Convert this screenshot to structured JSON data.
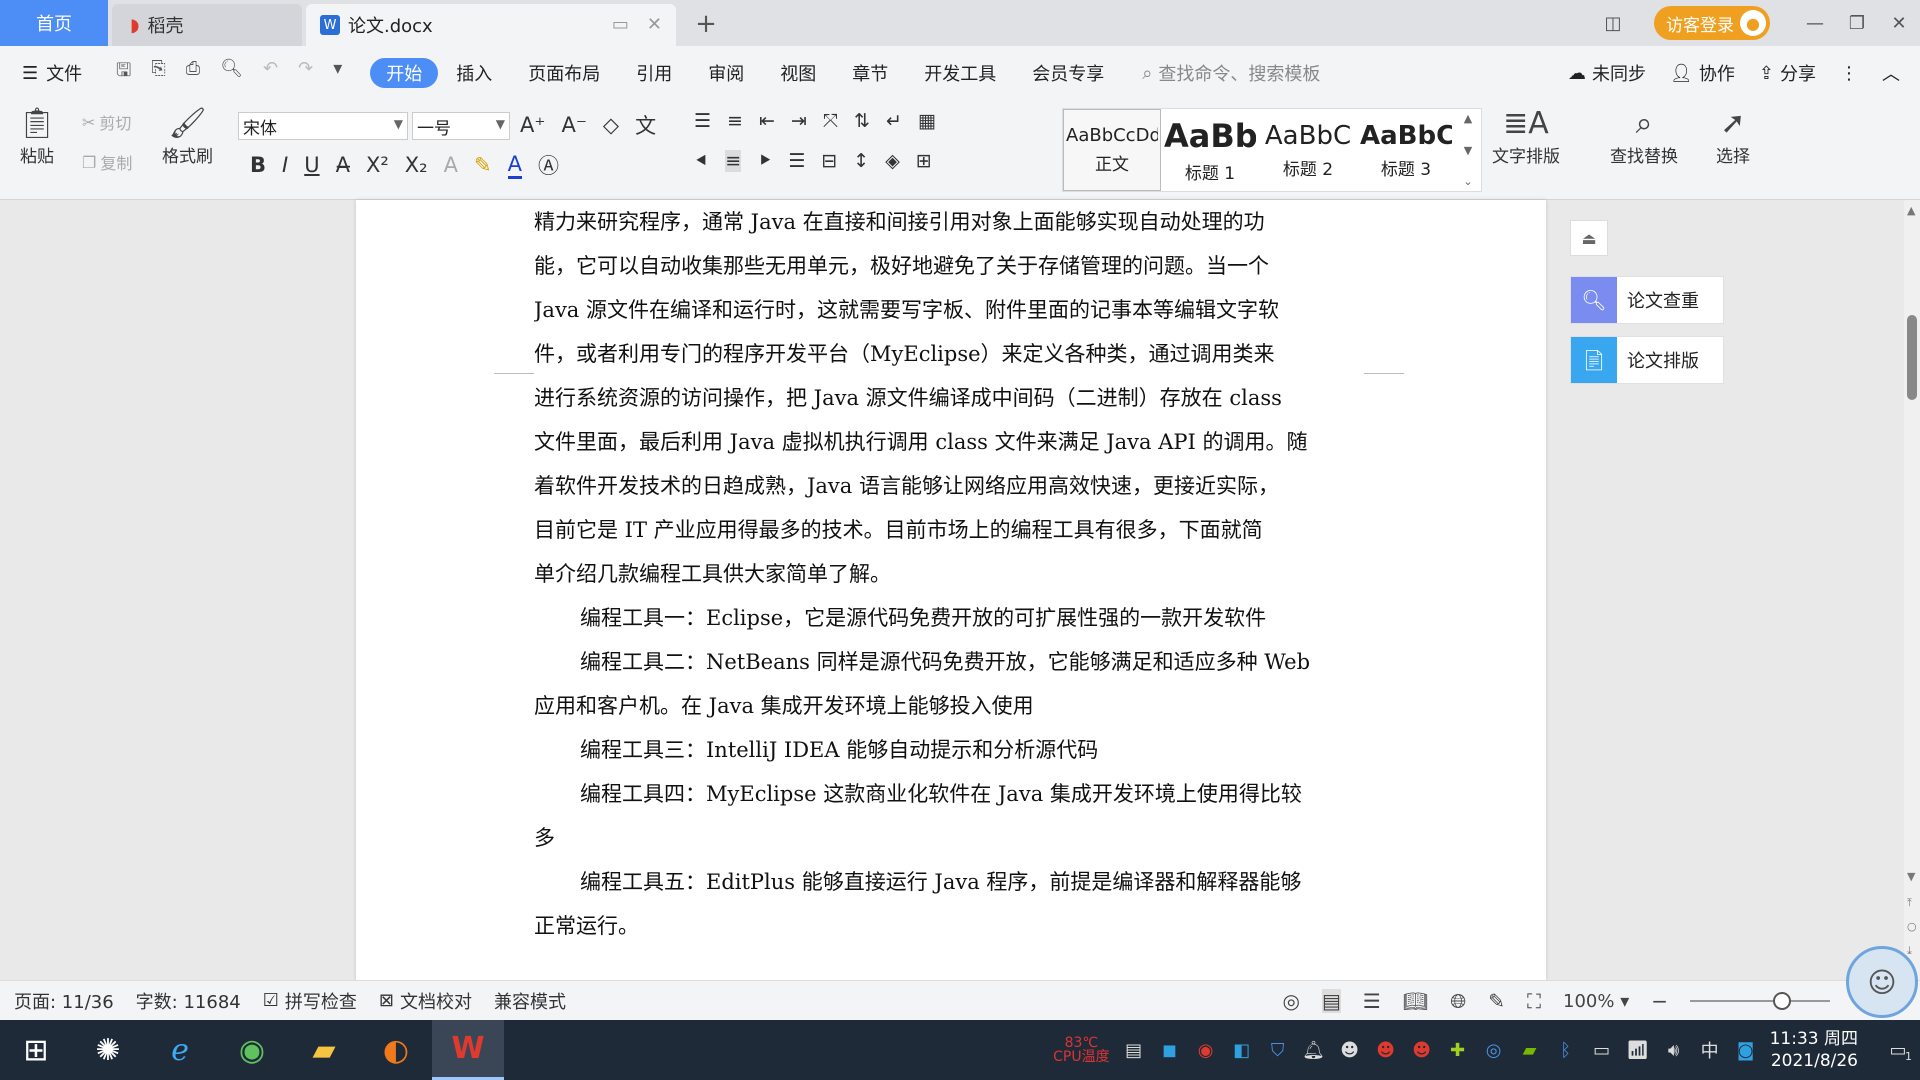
{
  "tabs": {
    "home": "首页",
    "daoke": "稻壳",
    "doc": "论文.docx",
    "login": "访客登录"
  },
  "menu": {
    "file": "文件",
    "tabs": [
      "开始",
      "插入",
      "页面布局",
      "引用",
      "审阅",
      "视图",
      "章节",
      "开发工具",
      "会员专享"
    ],
    "search_placeholder": "查找命令、搜索模板",
    "unsynced": "未同步",
    "collab": "协作",
    "share": "分享"
  },
  "ribbon": {
    "paste": "粘贴",
    "cut": "剪切",
    "copy": "复制",
    "format_painter": "格式刷",
    "font": "宋体",
    "size": "一号",
    "styles": [
      {
        "preview": "AaBbCcDd",
        "name": "正文"
      },
      {
        "preview": "AaBb",
        "name": "标题 1"
      },
      {
        "preview": "AaBbC",
        "name": "标题 2"
      },
      {
        "preview": "AaBbC",
        "name": "标题 3"
      }
    ],
    "text_layout": "文字排版",
    "find_replace": "查找替换",
    "select": "选择"
  },
  "document": {
    "lines": [
      {
        "text": "精力来研究程序，通常 Java 在直接和间接引用对象上面能够实现自动处理的功",
        "indent": false
      },
      {
        "text": "能，它可以自动收集那些无用单元，极好地避免了关于存储管理的问题。当一个",
        "indent": false
      },
      {
        "text": "Java 源文件在编译和运行时，这就需要写字板、附件里面的记事本等编辑文字软",
        "indent": false
      },
      {
        "text": "件，或者利用专门的程序开发平台（MyEclipse）来定义各种类，通过调用类来",
        "indent": false
      },
      {
        "text": "进行系统资源的访问操作，把 Java 源文件编译成中间码（二进制）存放在 class",
        "indent": false
      },
      {
        "text": "文件里面，最后利用 Java 虚拟机执行调用 class 文件来满足 Java API 的调用。随",
        "indent": false
      },
      {
        "text": "着软件开发技术的日趋成熟，Java 语言能够让网络应用高效快速，更接近实际，",
        "indent": false
      },
      {
        "text": "目前它是 IT 产业应用得最多的技术。目前市场上的编程工具有很多，下面就简",
        "indent": false
      },
      {
        "text": "单介绍几款编程工具供大家简单了解。",
        "indent": false
      },
      {
        "text": "编程工具一：Eclipse，它是源代码免费开放的可扩展性强的一款开发软件",
        "indent": true
      },
      {
        "text": "编程工具二：NetBeans 同样是源代码免费开放，它能够满足和适应多种 Web",
        "indent": true
      },
      {
        "text": "应用和客户机。在 Java 集成开发环境上能够投入使用",
        "indent": false
      },
      {
        "text": "编程工具三：IntelliJ IDEA 能够自动提示和分析源代码",
        "indent": true
      },
      {
        "text": "编程工具四：MyEclipse 这款商业化软件在 Java 集成开发环境上使用得比较",
        "indent": true
      },
      {
        "text": "多",
        "indent": false
      },
      {
        "text": "编程工具五：EditPlus 能够直接运行 Java 程序，前提是编译器和解释器能够",
        "indent": true
      },
      {
        "text": "正常运行。",
        "indent": false
      }
    ]
  },
  "side_panel": {
    "check": "论文查重",
    "layout": "论文排版"
  },
  "status": {
    "page": "页面: 11/36",
    "words": "字数: 11684",
    "spell": "拼写检查",
    "proof": "文档校对",
    "compat": "兼容模式",
    "zoom": "100%",
    "zoom_level": 0.66
  },
  "taskbar": {
    "cpu_temp_value": "83℃",
    "cpu_temp_label": "CPU温度",
    "ime": "中",
    "time": "11:33 周四",
    "date": "2021/8/26",
    "notif_count": "1"
  },
  "colors": {
    "accent": "#4c8df6",
    "login": "#f0a020",
    "wps_red": "#e03a2e"
  }
}
